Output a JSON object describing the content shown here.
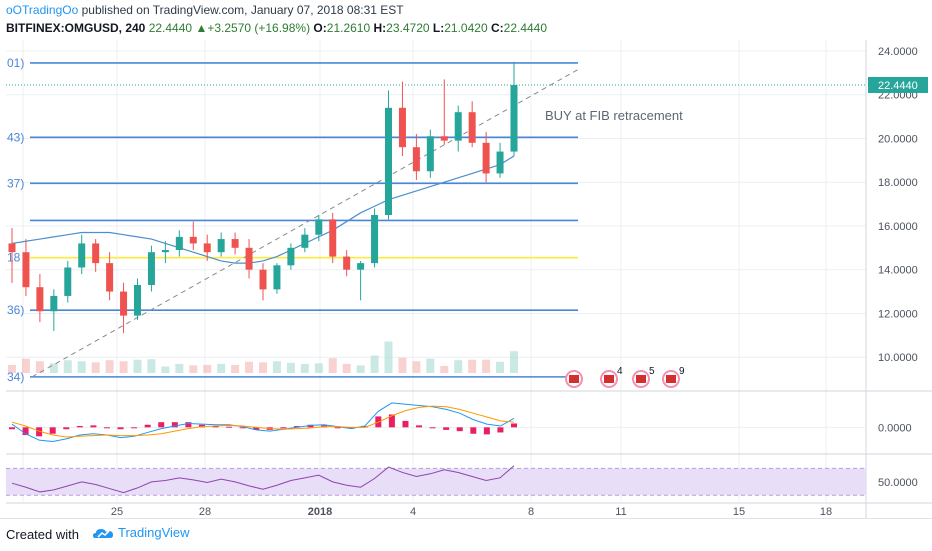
{
  "header": {
    "author": "oOTradingOo",
    "published_text": " published on TradingView.com, January 07, 2018 08:31 EST",
    "symbol": "BITFINEX:OMGUSD, 240",
    "last": "22.4440",
    "change": "+3.2570 (+16.98%)",
    "o_label": "O:",
    "o_value": "21.2610",
    "h_label": "H:",
    "h_value": "23.4720",
    "l_label": "L:",
    "l_value": "21.0420",
    "c_label": "C:",
    "c_value": "22.4440"
  },
  "footer": {
    "created_with": "Created with",
    "brand": "TradingView"
  },
  "colors": {
    "up": "#26a69a",
    "down": "#ef5350",
    "fib": "#4a86d8",
    "fib_yellow": "#ffeb3b",
    "ma": "#4b8fcf",
    "macd": "#2196f3",
    "signal": "#ff9800",
    "hist": "#e91e63",
    "rsi": "#8e44ad",
    "rsi_band": "#e8def7"
  },
  "chart_data": [
    {
      "type": "candlestick",
      "title": "",
      "ylim": [
        8.5,
        24.5
      ],
      "x_ticks": [
        "25",
        "28",
        "2018",
        "4",
        "8",
        "11",
        "15",
        "18"
      ],
      "y_ticks": [
        "24.0000",
        "22.0000",
        "20.0000",
        "18.0000",
        "16.0000",
        "14.0000",
        "12.0000",
        "10.0000"
      ],
      "last_price": 22.444,
      "annotation": "BUY at FIB retracement",
      "fib_levels": [
        {
          "label": "01)",
          "value": 23.45
        },
        {
          "label": "43)",
          "value": 20.05
        },
        {
          "label": "37)",
          "value": 17.95
        },
        {
          "label": "",
          "value": 16.25
        },
        {
          "label": "18",
          "value": 14.55
        },
        {
          "label": "36)",
          "value": 12.15
        },
        {
          "label": "34)",
          "value": 9.1
        }
      ],
      "trendline": [
        [
          9.1
        ],
        [
          23.2
        ]
      ],
      "ma_values": [
        15.2,
        15.3,
        15.4,
        15.5,
        15.6,
        15.7,
        15.7,
        15.7,
        15.6,
        15.5,
        15.4,
        15.2,
        15.0,
        14.8,
        14.6,
        14.4,
        14.3,
        14.3,
        14.4,
        14.6,
        14.9,
        15.2,
        15.5,
        15.8,
        16.2,
        16.6,
        16.9,
        17.2,
        17.4,
        17.6,
        17.8,
        18.0,
        18.2,
        18.4,
        18.6,
        18.8,
        19.2
      ],
      "candles": [
        [
          15.2,
          15.9,
          13.4,
          14.8
        ],
        [
          14.8,
          15.4,
          12.8,
          13.2
        ],
        [
          13.2,
          13.8,
          11.6,
          12.1
        ],
        [
          12.1,
          13.1,
          11.2,
          12.8
        ],
        [
          12.8,
          14.4,
          12.5,
          14.1
        ],
        [
          14.1,
          15.6,
          13.8,
          15.2
        ],
        [
          15.2,
          15.4,
          13.9,
          14.3
        ],
        [
          14.3,
          14.8,
          12.6,
          13.0
        ],
        [
          13.0,
          13.4,
          11.1,
          11.9
        ],
        [
          11.9,
          13.6,
          11.7,
          13.3
        ],
        [
          13.3,
          15.1,
          13.0,
          14.8
        ],
        [
          14.8,
          15.3,
          14.3,
          14.9
        ],
        [
          14.9,
          15.8,
          14.6,
          15.5
        ],
        [
          15.5,
          16.2,
          14.9,
          15.2
        ],
        [
          15.2,
          15.6,
          14.4,
          14.8
        ],
        [
          14.8,
          15.7,
          14.6,
          15.4
        ],
        [
          15.4,
          15.7,
          14.7,
          15.0
        ],
        [
          15.0,
          15.4,
          13.6,
          14.0
        ],
        [
          14.0,
          14.3,
          12.6,
          13.1
        ],
        [
          13.1,
          14.3,
          12.9,
          14.2
        ],
        [
          14.2,
          15.2,
          14.0,
          15.0
        ],
        [
          15.0,
          15.9,
          14.8,
          15.6
        ],
        [
          15.6,
          16.5,
          15.3,
          16.3
        ],
        [
          16.3,
          16.6,
          14.3,
          14.6
        ],
        [
          14.6,
          14.9,
          13.7,
          14.0
        ],
        [
          14.0,
          14.4,
          12.6,
          14.3
        ],
        [
          14.3,
          16.8,
          14.1,
          16.5
        ],
        [
          16.5,
          22.2,
          16.3,
          21.4
        ],
        [
          21.4,
          22.6,
          19.2,
          19.6
        ],
        [
          19.6,
          20.2,
          18.1,
          18.5
        ],
        [
          18.5,
          20.4,
          18.2,
          20.1
        ],
        [
          20.1,
          22.7,
          19.7,
          19.9
        ],
        [
          19.9,
          21.5,
          19.4,
          21.2
        ],
        [
          21.2,
          21.7,
          19.6,
          19.8
        ],
        [
          19.8,
          20.3,
          18.0,
          18.4
        ],
        [
          18.4,
          19.8,
          18.2,
          19.4
        ],
        [
          19.4,
          23.5,
          19.2,
          22.44
        ]
      ]
    },
    {
      "type": "line",
      "title": "",
      "ylim": [
        -0.4,
        0.55
      ],
      "y_ticks": [
        "0.0000"
      ],
      "series": [
        {
          "role": "macd",
          "values": [
            0.05,
            -0.1,
            -0.2,
            -0.22,
            -0.18,
            -0.12,
            -0.1,
            -0.12,
            -0.16,
            -0.14,
            -0.08,
            -0.02,
            0.02,
            0.06,
            0.05,
            0.04,
            0.04,
            0.01,
            -0.04,
            -0.06,
            -0.03,
            0.0,
            0.03,
            0.04,
            0.01,
            -0.02,
            0.02,
            0.25,
            0.38,
            0.36,
            0.34,
            0.32,
            0.28,
            0.22,
            0.12,
            0.05,
            0.02,
            0.14
          ]
        },
        {
          "role": "signal",
          "values": [
            0.08,
            0.02,
            -0.06,
            -0.12,
            -0.15,
            -0.14,
            -0.13,
            -0.12,
            -0.13,
            -0.13,
            -0.12,
            -0.1,
            -0.06,
            -0.02,
            0.01,
            0.02,
            0.03,
            0.02,
            0.0,
            -0.02,
            -0.03,
            -0.02,
            -0.01,
            0.01,
            0.01,
            0.0,
            0.0,
            0.08,
            0.18,
            0.26,
            0.31,
            0.33,
            0.32,
            0.28,
            0.22,
            0.16,
            0.1,
            0.08
          ]
        }
      ],
      "histogram": [
        -0.03,
        -0.12,
        -0.14,
        -0.1,
        -0.03,
        0.02,
        0.03,
        0.0,
        -0.03,
        -0.01,
        0.04,
        0.08,
        0.08,
        0.08,
        0.04,
        0.02,
        0.01,
        -0.01,
        -0.04,
        -0.04,
        0.0,
        0.02,
        0.04,
        0.03,
        0.0,
        -0.02,
        0.02,
        0.17,
        0.2,
        0.1,
        0.03,
        -0.01,
        -0.04,
        -0.06,
        -0.1,
        -0.11,
        -0.08,
        0.06
      ]
    },
    {
      "type": "line",
      "title": "",
      "ylim": [
        20,
        90
      ],
      "y_ticks": [
        "50.0000"
      ],
      "series": [
        {
          "role": "rsi",
          "values": [
            48,
            42,
            35,
            38,
            44,
            50,
            46,
            40,
            34,
            41,
            50,
            52,
            56,
            53,
            49,
            54,
            50,
            44,
            39,
            45,
            52,
            56,
            60,
            50,
            45,
            42,
            55,
            72,
            64,
            58,
            62,
            68,
            64,
            58,
            52,
            56,
            74
          ]
        }
      ],
      "bands": [
        30,
        70
      ]
    }
  ]
}
